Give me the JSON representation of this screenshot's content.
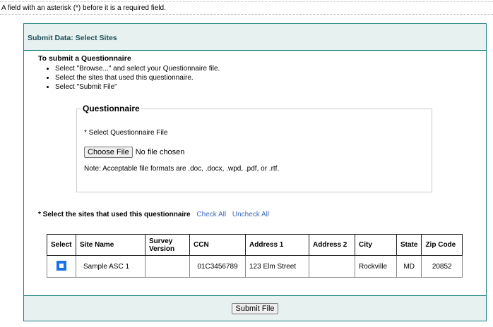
{
  "required_note": "A field with an asterisk (*) before it is a required field.",
  "panel_title": "Submit Data: Select Sites",
  "intro": {
    "heading": "To submit a Questionnaire",
    "steps": [
      "Select \"Browse...\" and select your Questionnaire file.",
      "Select the sites that used this questionnaire.",
      "Select \"Submit File\""
    ]
  },
  "questionnaire": {
    "legend": "Questionnaire",
    "file_label": "* Select Questionnaire File",
    "choose_button": "Choose File",
    "file_status": "No file chosen",
    "formats_note": "Note: Acceptable file formats are .doc, .docx, .wpd, .pdf, or .rtf."
  },
  "sites": {
    "label": "* Select the sites that used this questionnaire",
    "check_all": "Check All",
    "uncheck_all": "Uncheck All",
    "columns": [
      "Select",
      "Site Name",
      "Survey Version",
      "CCN",
      "Address 1",
      "Address 2",
      "City",
      "State",
      "Zip Code"
    ],
    "rows": [
      {
        "checked": false,
        "site_name": "Sample ASC 1",
        "survey_version": "",
        "ccn": "01C3456789",
        "address1": "123 Elm Street",
        "address2": "",
        "city": "Rockville",
        "state": "MD",
        "zip": "20852"
      }
    ]
  },
  "submit_label": "Submit File"
}
